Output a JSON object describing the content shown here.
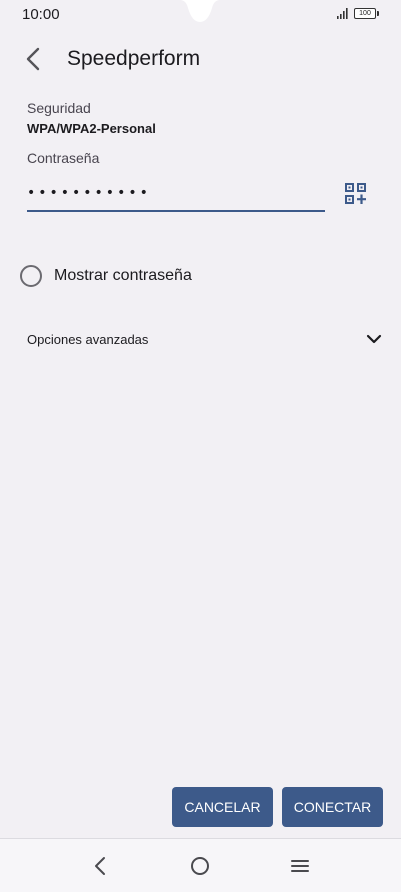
{
  "status_bar": {
    "time": "10:00",
    "battery": "100"
  },
  "header": {
    "title": "Speedperform"
  },
  "security": {
    "label": "Seguridad",
    "value": "WPA/WPA2-Personal"
  },
  "password": {
    "label": "Contraseña",
    "value": "•••••••••••"
  },
  "show_password": {
    "label": "Mostrar contraseña",
    "checked": false
  },
  "advanced_options": {
    "label": "Opciones avanzadas"
  },
  "actions": {
    "cancel_label": "CANCELAR",
    "connect_label": "CONECTAR"
  },
  "icons": {
    "back": "arrow-back-icon",
    "qr": "qr-scan-icon",
    "expand": "chevron-down-icon",
    "nav_back": "nav-back-icon",
    "nav_home": "nav-home-icon",
    "nav_menu": "nav-menu-icon"
  },
  "colors": {
    "accent": "#3d5a8a",
    "background": "#f2f0f4"
  }
}
